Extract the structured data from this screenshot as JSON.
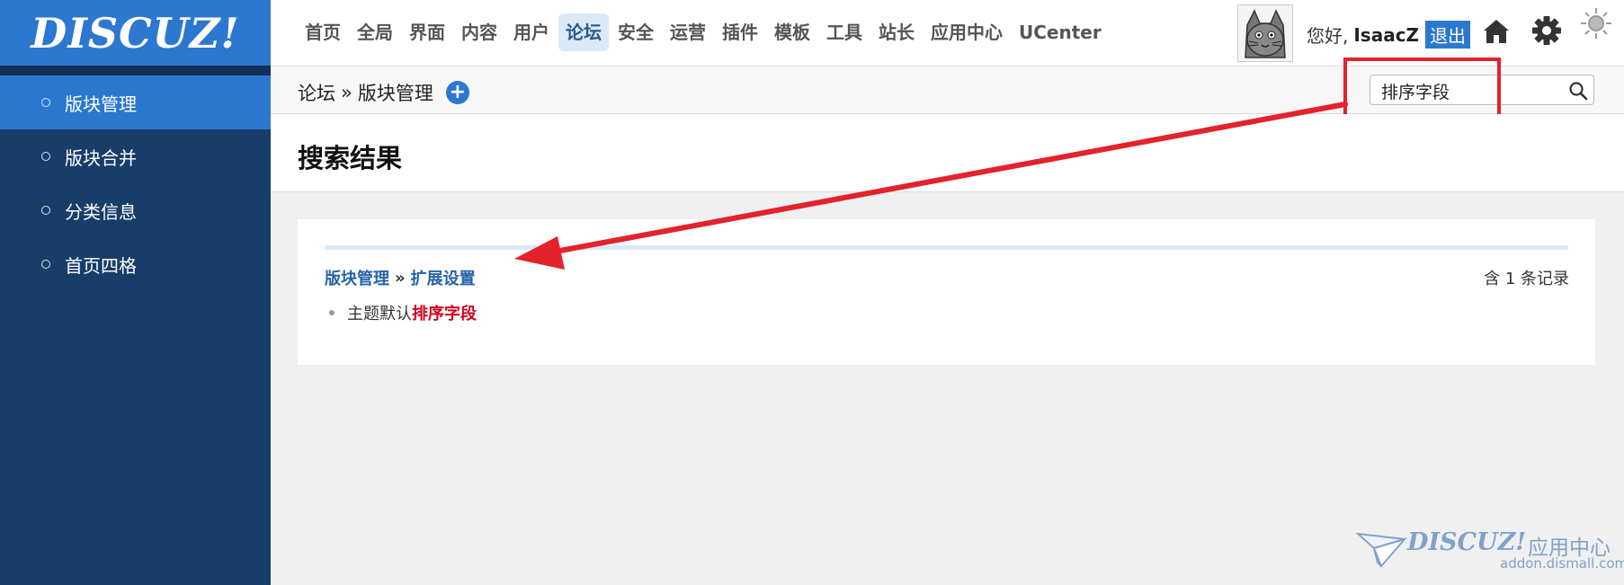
{
  "sidebar": {
    "logo": "DISCUZ!",
    "items": [
      {
        "label": "版块管理"
      },
      {
        "label": "版块合并"
      },
      {
        "label": "分类信息"
      },
      {
        "label": "首页四格"
      }
    ]
  },
  "nav": {
    "items": [
      "首页",
      "全局",
      "界面",
      "内容",
      "用户",
      "论坛",
      "安全",
      "运营",
      "插件",
      "模板",
      "工具",
      "站长",
      "应用中心",
      "UCenter"
    ],
    "active": "论坛"
  },
  "header": {
    "greeting": "您好,",
    "username": "IsaacZ",
    "logout": "退出"
  },
  "breadcrumb": {
    "parent": "论坛",
    "separator": "»",
    "current": "版块管理",
    "add_symbol": "+"
  },
  "search": {
    "value": "排序字段"
  },
  "page": {
    "title": "搜索结果"
  },
  "result": {
    "path_parent": "版块管理",
    "path_separator": "»",
    "path_child": "扩展设置",
    "count_text": "含 1 条记录",
    "item_prefix": "主题默认",
    "item_match": "排序字段"
  },
  "watermark": {
    "brand": "DISCUZ!",
    "brand_zh": "应用中心",
    "url": "addon.dismall.com"
  },
  "colors": {
    "sidebar": "#183d68",
    "accent": "#2c78d1",
    "highlight": "#e3222b",
    "match": "#d0021b"
  }
}
